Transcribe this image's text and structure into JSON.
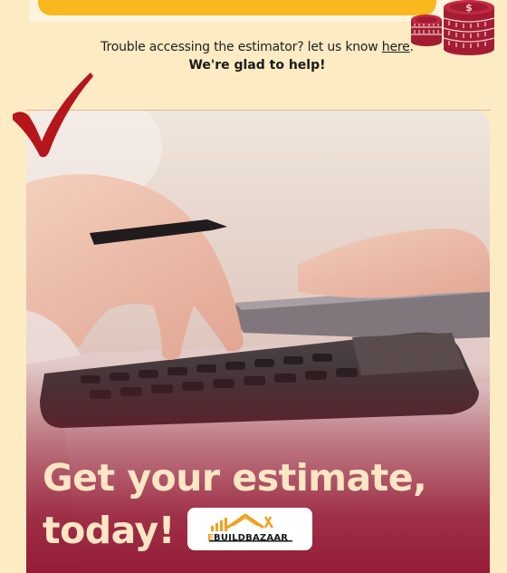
{
  "help": {
    "prefix": "Trouble accessing the estimator? let us know ",
    "link": "here",
    "suffix": ".",
    "line2": "We're glad to help!"
  },
  "hero": {
    "headline_line1": "Get your estimate,",
    "headline_line2": "today!"
  },
  "logo": {
    "letter_e": "E",
    "wordmark": "BUILDBAZAAR"
  },
  "colors": {
    "background": "#fdebc4",
    "accent_yellow": "#f9b91e",
    "brand_maroon": "#a11a36",
    "headline_cream": "#fde6c4"
  },
  "icons": {
    "coins": "coin-stack-icon",
    "check": "checkmark-icon",
    "logo": "house-roof-logo-icon"
  }
}
